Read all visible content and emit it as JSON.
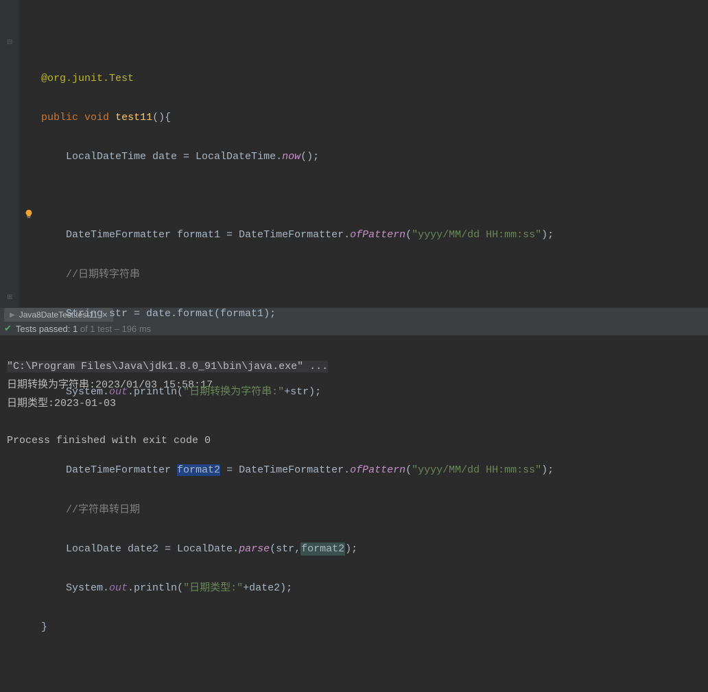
{
  "code": {
    "l1_ann": "@org.junit.Test",
    "l2_kw_public": "public",
    "l2_kw_void": "void",
    "l2_method": "test11",
    "l2_tail": "(){",
    "l3_pre": "LocalDateTime date = LocalDateTime.",
    "l3_static": "now",
    "l3_tail": "();",
    "l5_pre": "DateTimeFormatter format1 = DateTimeFormatter.",
    "l5_static": "ofPattern",
    "l5_p": "(",
    "l5_str": "\"yyyy/MM/dd HH:mm:ss\"",
    "l5_tail": ");",
    "l6_cmt1": "//",
    "l6_cmt2": "日期转字符串",
    "l7": "String str = date.format(format1);",
    "l9_pre": "System.",
    "l9_out": "out",
    "l9_print": ".println(",
    "l9_str": "\"日期转换为字符串:\"",
    "l9_tail": "+str);",
    "l11_pre": "DateTimeFormatter ",
    "l11_fmt2": "format2",
    "l11_mid": " = DateTimeFormatter.",
    "l11_static": "ofPattern",
    "l11_p": "(",
    "l11_str": "\"yyyy/MM/dd HH:mm:ss\"",
    "l11_tail": ");",
    "l12_cmt1": "//",
    "l12_cmt2": "字符串转日期",
    "l13_pre": "LocalDate date2 = LocalDate.",
    "l13_static": "parse",
    "l13_p": "(str,",
    "l13_fmt2": "format2",
    "l13_tail": ");",
    "l14_pre": "System.",
    "l14_out": "out",
    "l14_print": ".println(",
    "l14_str": "\"日期类型:\"",
    "l14_tail": "+date2);",
    "l15": "}"
  },
  "panel": {
    "tab_label": "Java8DateTest.test11"
  },
  "run_status": {
    "prefix": "Tests passed: 1",
    "suffix": " of 1 test – 196 ms"
  },
  "console": {
    "cmd": "\"C:\\Program Files\\Java\\jdk1.8.0_91\\bin\\java.exe\" ...",
    "line1": "日期转换为字符串:2023/01/03 15:58:17",
    "line2": "日期类型:2023-01-03",
    "exit": "Process finished with exit code 0"
  }
}
